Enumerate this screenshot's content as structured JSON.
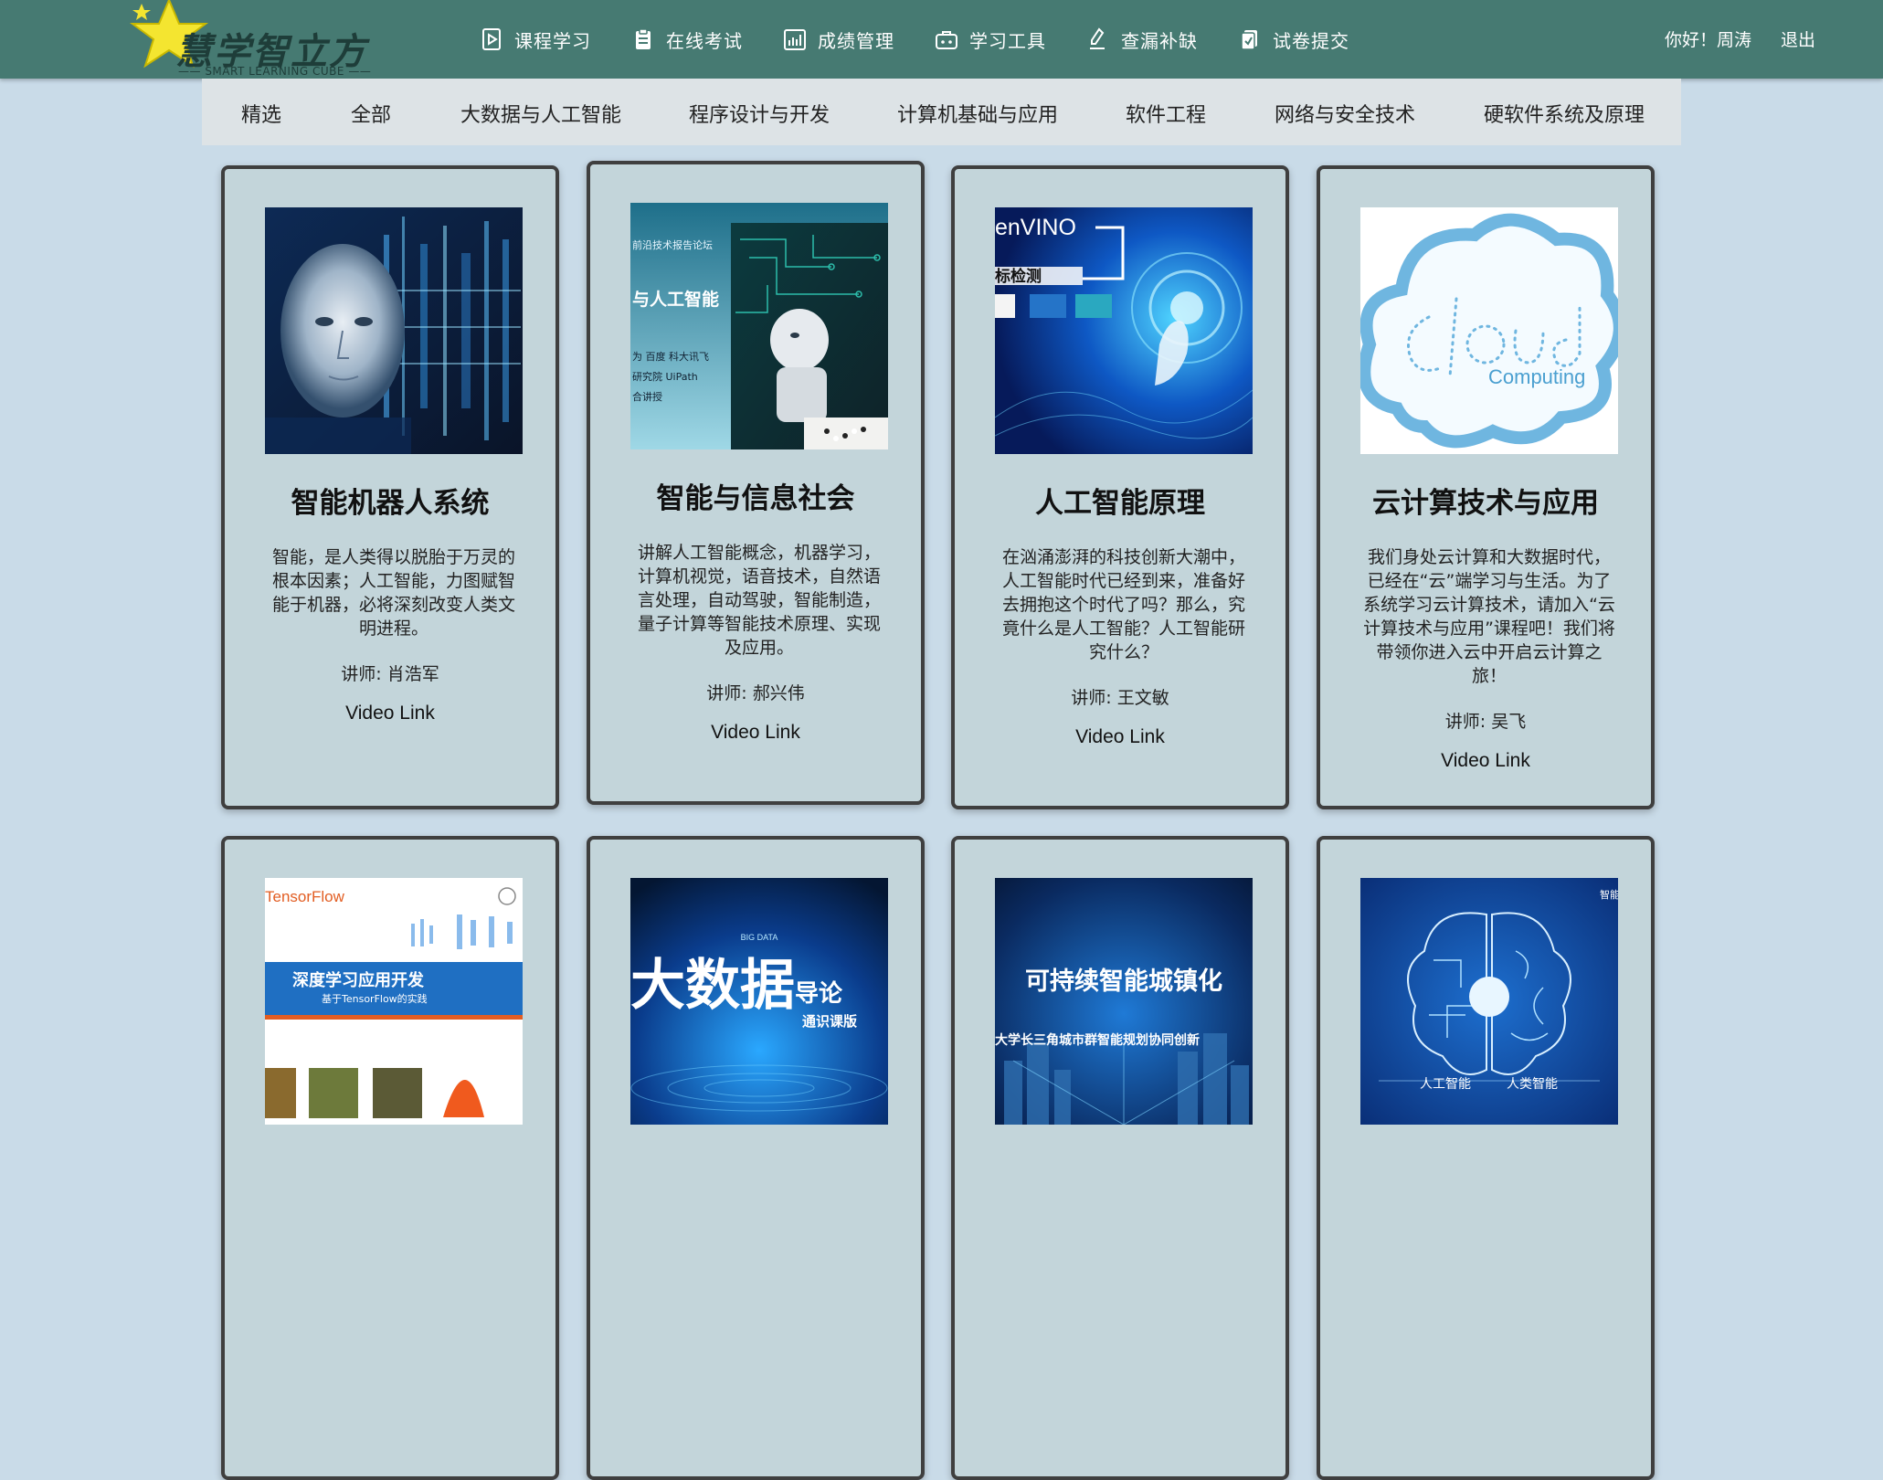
{
  "header": {
    "logo_text": "慧学智立方",
    "logo_sub": "—— SMART LEARNING CUBE ——",
    "nav": [
      {
        "label": "课程学习",
        "icon": "play-document-icon"
      },
      {
        "label": "在线考试",
        "icon": "clipboard-icon"
      },
      {
        "label": "成绩管理",
        "icon": "chart-icon"
      },
      {
        "label": "学习工具",
        "icon": "toolbox-icon"
      },
      {
        "label": "查漏补缺",
        "icon": "pen-icon"
      },
      {
        "label": "试卷提交",
        "icon": "submit-icon"
      }
    ],
    "greeting": "你好！周涛",
    "logout": "退出"
  },
  "categories": [
    "精选",
    "全部",
    "大数据与人工智能",
    "程序设计与开发",
    "计算机基础与应用",
    "软件工程",
    "网络与安全技术",
    "硬软件系统及原理"
  ],
  "cards": [
    {
      "title": "智能机器人系统",
      "desc": "智能，是人类得以脱胎于万灵的根本因素；人工智能，力图赋智能于机器，必将深刻改变人类文明进程。",
      "teacher": "讲师: 肖浩军",
      "video": "Video Link",
      "image": "robot-face-image"
    },
    {
      "title": "智能与信息社会",
      "desc": "讲解人工智能概念，机器学习，计算机视觉，语音技术，自然语言处理，自动驾驶，智能制造，量子计算等智能技术原理、实现及应用。",
      "teacher": "讲师: 郝兴伟",
      "video": "Video Link",
      "image": "robot-chess-image",
      "image_text": [
        "前沿技术报告论坛",
        "与人工智能",
        "为 百度 科大讯飞",
        "研究院 UiPath",
        "合讲授"
      ]
    },
    {
      "title": "人工智能原理",
      "desc": "在汹涌澎湃的科技创新大潮中，人工智能时代已经到来，准备好去拥抱这个时代了吗？那么，究竟什么是人工智能？人工智能研究什么？",
      "teacher": "讲师: 王文敏",
      "video": "Video Link",
      "image": "openvino-hand-image",
      "image_text": [
        "enVINO",
        "标检测"
      ]
    },
    {
      "title": "云计算技术与应用",
      "desc": "我们身处云计算和大数据时代，已经在“云”端学习与生活。为了系统学习云计算技术，请加入“云计算技术与应用”课程吧！我们将带领你进入云中开启云计算之旅！",
      "teacher": "讲师: 吴飞",
      "video": "Video Link",
      "image": "cloud-computing-image",
      "image_text": [
        "cloud",
        "Computing"
      ]
    },
    {
      "image": "tensorflow-book-image",
      "image_text": [
        "TensorFlow",
        "深度学习应用开发",
        "基于TensorFlow的实践"
      ]
    },
    {
      "image": "big-data-image",
      "image_text": [
        "大数据",
        "导论",
        "通识课版",
        "BIG DATA"
      ]
    },
    {
      "image": "smart-city-image",
      "image_text": [
        "可持续智能城镇化",
        "大学长三角城市群智能规划协同创新"
      ]
    },
    {
      "image": "brain-circuit-image",
      "image_text": [
        "智能",
        "人工智能",
        "人类智能"
      ]
    }
  ],
  "colors": {
    "header_bg": "#467a72",
    "page_bg": "#c9dbe8",
    "card_bg": "#c3d5da",
    "category_bg": "#dde3e6",
    "logo_star": "#f4e530"
  }
}
